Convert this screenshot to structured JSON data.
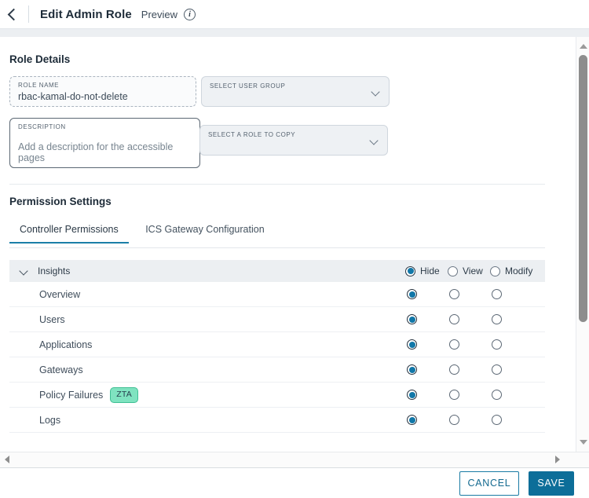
{
  "header": {
    "back_icon": "chevron-left-icon",
    "title": "Edit Admin Role",
    "preview_label": "Preview",
    "info_icon": "info-icon",
    "info_glyph": "i"
  },
  "role_details": {
    "section_title": "Role Details",
    "role_name": {
      "label": "ROLE NAME",
      "value": "rbac-kamal-do-not-delete"
    },
    "user_group": {
      "label": "SELECT USER GROUP",
      "value": ""
    },
    "description": {
      "label": "DESCRIPTION",
      "placeholder": "Add a description for the accessible pages"
    },
    "role_to_copy": {
      "label": "SELECT A ROLE TO COPY",
      "value": ""
    }
  },
  "permission_settings": {
    "section_title": "Permission Settings",
    "tabs": [
      {
        "label": "Controller Permissions",
        "active": true
      },
      {
        "label": "ICS Gateway Configuration",
        "active": false
      }
    ],
    "group": {
      "name": "Insights",
      "expanded": true,
      "caret_icon": "chevron-down-icon",
      "options": [
        {
          "label": "Hide",
          "selected": true
        },
        {
          "label": "View",
          "selected": false
        },
        {
          "label": "Modify",
          "selected": false
        }
      ]
    },
    "rows": [
      {
        "label": "Overview",
        "badge": "",
        "selected": "Hide"
      },
      {
        "label": "Users",
        "badge": "",
        "selected": "Hide"
      },
      {
        "label": "Applications",
        "badge": "",
        "selected": "Hide"
      },
      {
        "label": "Gateways",
        "badge": "",
        "selected": "Hide"
      },
      {
        "label": "Policy Failures",
        "badge": "ZTA",
        "selected": "Hide"
      },
      {
        "label": "Logs",
        "badge": "",
        "selected": "Hide"
      }
    ]
  },
  "scrollbars": {
    "vertical_up_icon": "triangle-up-icon",
    "vertical_down_icon": "triangle-down-icon",
    "horizontal_left_icon": "triangle-left-icon",
    "horizontal_right_icon": "triangle-right-icon"
  },
  "footer": {
    "cancel_label": "CANCEL",
    "save_label": "SAVE"
  },
  "colors": {
    "accent": "#0d6e99",
    "tab_underline": "#1b7fa8",
    "radio_fill": "#1177a8",
    "badge_bg": "#7fe3c0",
    "badge_border": "#3fbf94",
    "band": "#eceff2"
  }
}
